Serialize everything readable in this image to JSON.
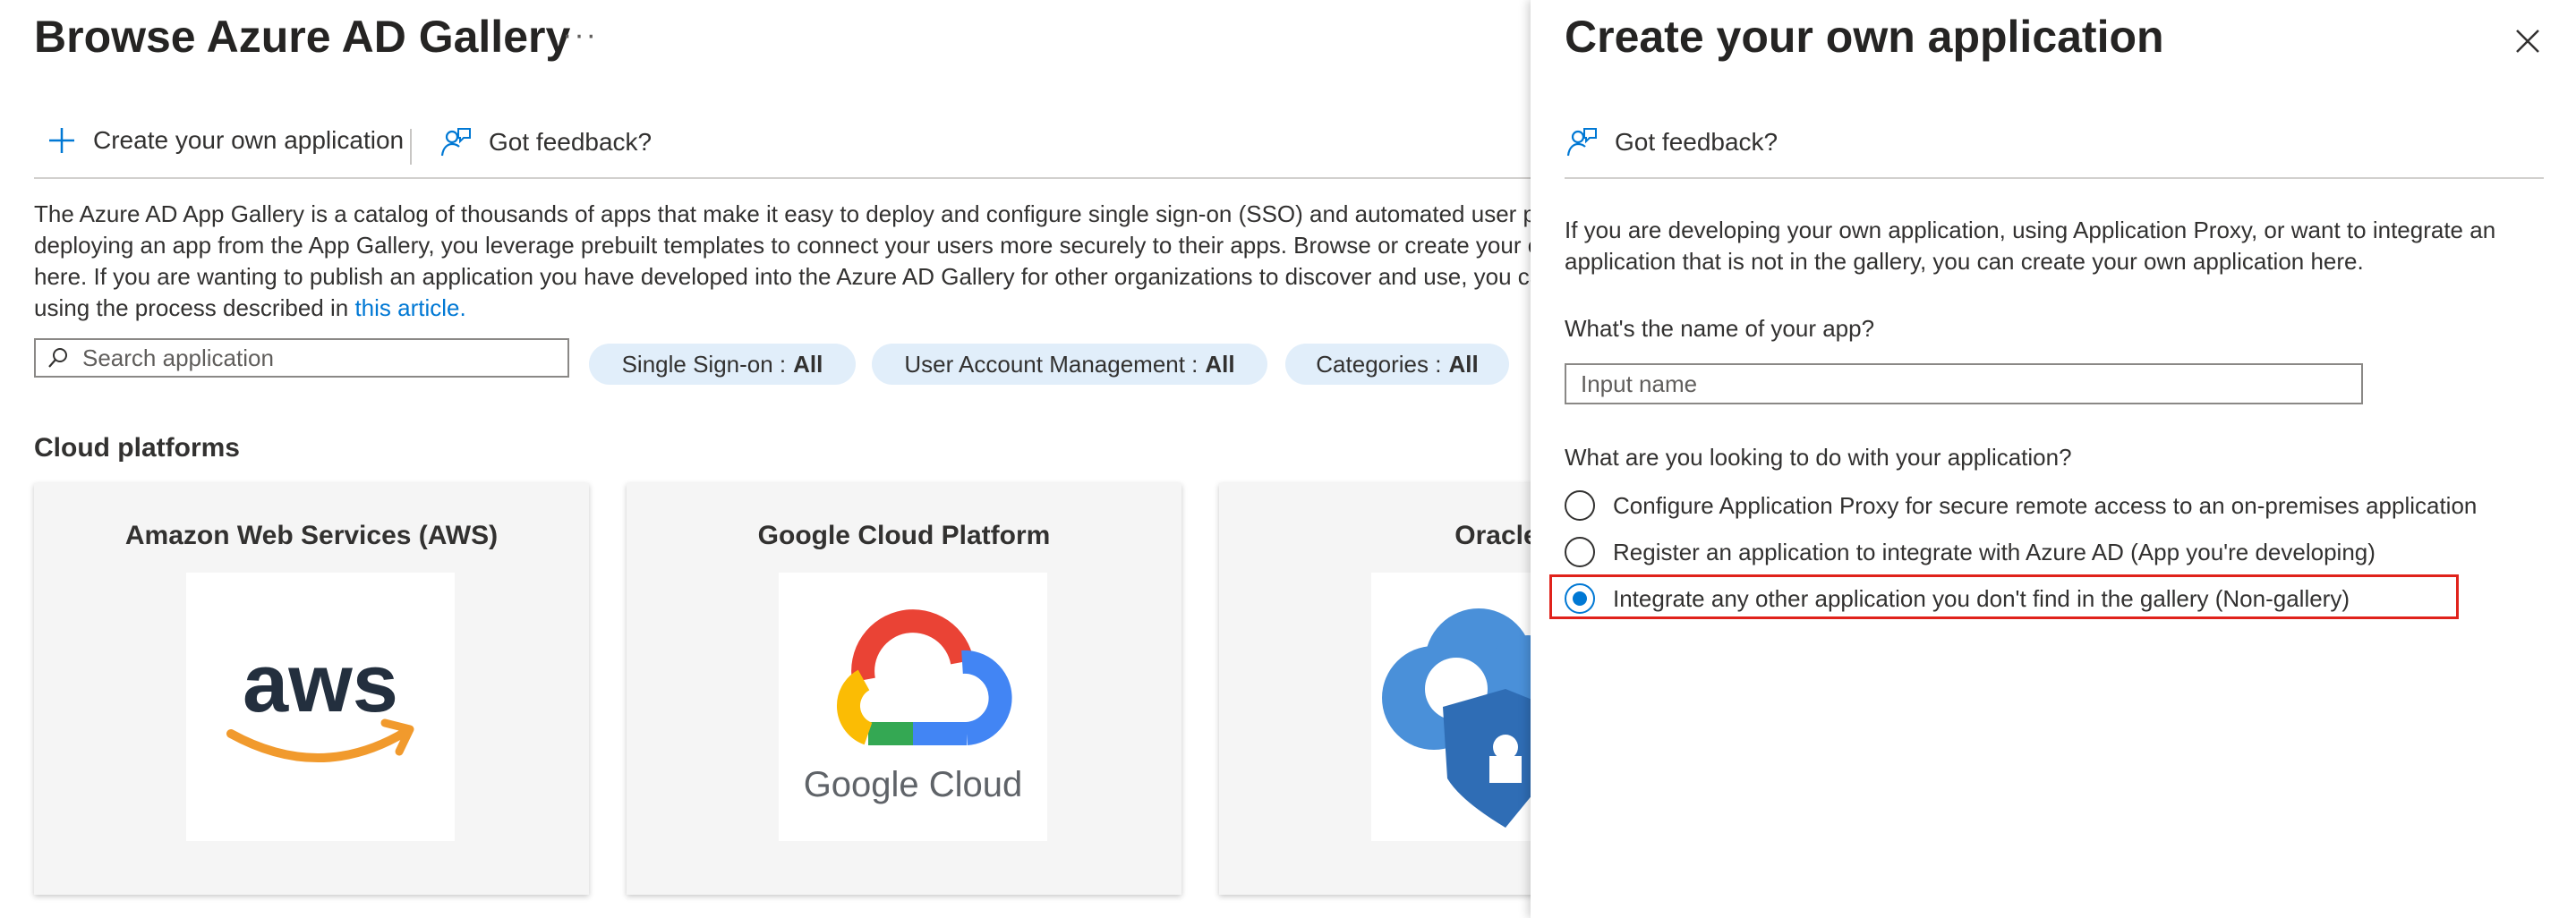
{
  "gallery": {
    "title": "Browse Azure AD Gallery",
    "more_label": "···",
    "commands": {
      "create_label": "Create your own application",
      "feedback_label": "Got feedback?"
    },
    "intro_text": "The Azure AD App Gallery is a catalog of thousands of apps that make it easy to deploy and configure single sign-on (SSO) and automated user provisioning. When deploying an app from the App Gallery, you leverage prebuilt templates to connect your users more securely to their apps. Browse or create your own application here. If you are wanting to publish an application you have developed into the Azure AD Gallery for other organizations to discover and use, you can file a request using the process described in",
    "intro_link": "this article.",
    "search": {
      "placeholder": "Search application"
    },
    "filters": [
      {
        "label": "Single Sign-on :",
        "value": "All"
      },
      {
        "label": "User Account Management :",
        "value": "All"
      },
      {
        "label": "Categories :",
        "value": "All"
      }
    ],
    "section_title": "Cloud platforms",
    "cards": [
      {
        "title": "Amazon Web Services (AWS)",
        "logo_text": "aws"
      },
      {
        "title": "Google Cloud Platform",
        "logo_text": "Google Cloud"
      },
      {
        "title": "Oracle"
      }
    ]
  },
  "panel": {
    "title": "Create your own application",
    "feedback_label": "Got feedback?",
    "description": "If you are developing your own application, using Application Proxy, or want to integrate an application that is not in the gallery, you can create your own application here.",
    "name_question": "What's the name of your app?",
    "name_placeholder": "Input name",
    "purpose_question": "What are you looking to do with your application?",
    "options": [
      {
        "label": "Configure Application Proxy for secure remote access to an on-premises application",
        "selected": false
      },
      {
        "label": "Register an application to integrate with Azure AD (App you're developing)",
        "selected": false
      },
      {
        "label": "Integrate any other application you don't find in the gallery (Non-gallery)",
        "selected": true
      }
    ]
  },
  "colors": {
    "accent": "#0078d4",
    "highlight": "#e0221b",
    "pill_bg": "#e1eefa"
  }
}
